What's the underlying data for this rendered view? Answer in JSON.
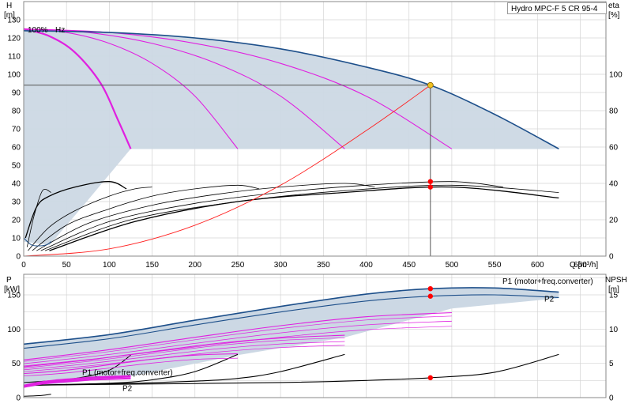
{
  "title": "Hydro MPC-F 5 CR 95-4",
  "top_label": "100%",
  "top_label_suffix": "Hz",
  "colors": {
    "envelope_fill": "#ccd8e4",
    "max_curve": "#1d4f8a",
    "speed_curves": "#e020e0",
    "system_curve": "#ff2020",
    "eta_curves": "#000000",
    "duty_point": "#f0c020",
    "markers": "#ff0000",
    "grid": "#d4d4d4"
  },
  "chart_data": [
    {
      "type": "line",
      "name": "head",
      "xlabel": "Q [m³/h]",
      "ylabel": "H\n[m]",
      "y2label": "eta\n[%]",
      "xlim": [
        0,
        680
      ],
      "ylim": [
        0,
        140
      ],
      "y2lim": [
        0,
        140
      ],
      "xticks": [
        0,
        50,
        100,
        150,
        200,
        250,
        300,
        350,
        400,
        450,
        500,
        550,
        600,
        650
      ],
      "yticks": [
        0,
        10,
        20,
        30,
        40,
        50,
        60,
        70,
        80,
        90,
        100,
        110,
        120,
        130
      ],
      "y2ticks": [
        0,
        20,
        40,
        60,
        80,
        100
      ],
      "grid": true,
      "series": [
        {
          "x": [
            0,
            100,
            200,
            300,
            400,
            475,
            550,
            625
          ],
          "y": [
            124,
            123,
            120,
            114,
            104,
            94,
            78,
            59
          ]
        },
        {
          "x": [
            0,
            30,
            60,
            90,
            110,
            125
          ],
          "y": [
            125,
            121,
            112,
            95,
            75,
            59
          ]
        },
        {
          "x": [
            0,
            50,
            100,
            150,
            200,
            250
          ],
          "y": [
            125,
            123,
            117,
            106,
            88,
            59
          ]
        },
        {
          "x": [
            0,
            75,
            150,
            225,
            300,
            375
          ],
          "y": [
            125,
            123,
            117,
            106,
            88,
            59
          ]
        },
        {
          "x": [
            0,
            100,
            200,
            300,
            400,
            500
          ],
          "y": [
            125,
            123,
            117,
            106,
            88,
            59
          ]
        },
        {
          "x": [
            0,
            100,
            200,
            300,
            400,
            475
          ],
          "y": [
            0,
            4,
            17,
            39,
            69,
            94
          ]
        },
        {
          "x": [
            2,
            15,
            30,
            60,
            100,
            120
          ],
          "y": [
            10,
            27,
            33,
            38,
            41,
            37
          ]
        },
        {
          "x": [
            5,
            30,
            60,
            100,
            130,
            150
          ],
          "y": [
            3,
            16,
            25,
            33,
            37,
            38
          ]
        },
        {
          "x": [
            10,
            50,
            100,
            150,
            200,
            250,
            275
          ],
          "y": [
            3,
            17,
            26,
            33,
            37,
            39,
            37
          ]
        },
        {
          "x": [
            15,
            75,
            150,
            225,
            300,
            375,
            410
          ],
          "y": [
            3,
            18,
            28,
            34,
            38,
            40,
            38
          ]
        },
        {
          "x": [
            20,
            100,
            200,
            300,
            400,
            500,
            560
          ],
          "y": [
            3,
            19,
            29,
            35,
            39,
            41,
            38
          ]
        },
        {
          "x": [
            25,
            125,
            250,
            375,
            500,
            625
          ],
          "y": [
            3,
            20,
            30,
            36,
            39,
            35
          ]
        },
        {
          "x": [
            30,
            130,
            250,
            375,
            500,
            625
          ],
          "y": [
            3,
            19,
            30,
            35,
            38,
            32
          ]
        }
      ],
      "duty_point": {
        "x": 475,
        "y": 94
      },
      "markers": [
        {
          "x": 475,
          "y": 41
        },
        {
          "x": 475,
          "y": 38
        }
      ]
    },
    {
      "type": "line",
      "name": "power",
      "ylabel": "P\n[kW]",
      "y2label": "NPSH\n[m]",
      "xlim": [
        0,
        680
      ],
      "ylim": [
        0,
        180
      ],
      "y2lim": [
        0,
        18
      ],
      "yticks": [
        0,
        50,
        100,
        150
      ],
      "y2ticks": [
        0,
        5,
        10,
        15
      ],
      "grid": true,
      "annotations": [
        "P1 (motor+freq.converter)",
        "P2",
        "P1 (motor+freq.converter)",
        "P2"
      ],
      "series": [
        {
          "x": [
            0,
            100,
            200,
            300,
            400,
            475,
            550,
            625
          ],
          "y": [
            78,
            92,
            113,
            133,
            151,
            159,
            160,
            154
          ]
        },
        {
          "x": [
            0,
            100,
            200,
            300,
            400,
            475,
            550,
            625
          ],
          "y": [
            72,
            86,
            106,
            125,
            141,
            148,
            150,
            146
          ]
        },
        {
          "x": [
            0,
            50,
            100,
            150,
            200,
            250
          ],
          "y": [
            35,
            40,
            48,
            56,
            62,
            64
          ]
        },
        {
          "x": [
            0,
            75,
            150,
            225,
            300,
            375
          ],
          "y": [
            45,
            55,
            67,
            79,
            87,
            91
          ]
        },
        {
          "x": [
            0,
            100,
            200,
            300,
            400,
            500
          ],
          "y": [
            55,
            70,
            88,
            105,
            118,
            124
          ]
        },
        {
          "x": [
            0,
            20,
            40,
            60,
            80,
            100,
            125
          ],
          "y": [
            17,
            22,
            25,
            27,
            29,
            30,
            31
          ]
        },
        {
          "x": [
            0,
            150,
            300,
            400,
            475,
            550,
            625
          ],
          "y": [
            18,
            20,
            22,
            25,
            29,
            37,
            63
          ]
        },
        {
          "x": [
            0,
            100,
            200,
            250,
            300,
            375
          ],
          "y": [
            18,
            20,
            24,
            28,
            38,
            63
          ]
        },
        {
          "x": [
            0,
            100,
            150,
            200,
            250
          ],
          "y": [
            18,
            21,
            26,
            38,
            63
          ]
        }
      ],
      "markers": [
        {
          "x": 475,
          "y": 159
        },
        {
          "x": 475,
          "y": 148
        },
        {
          "x": 475,
          "y": 29
        }
      ]
    }
  ]
}
